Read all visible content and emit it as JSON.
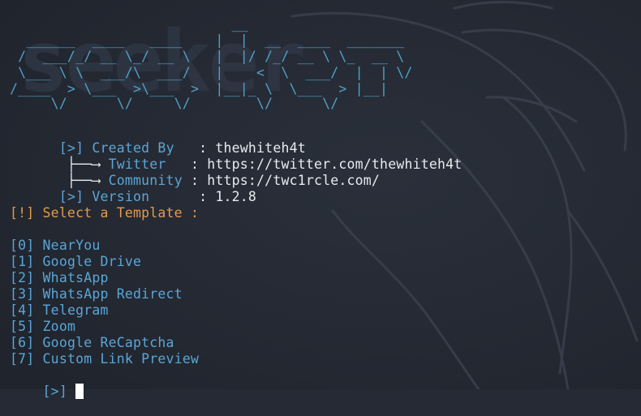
{
  "banner": {
    "ascii_lines": [
      "                           __",
      "  ______  ____   ____    |  |  __  ____  _______",
      " /  ___/_/ __ \\_/ __ \\   |  |/ /_/ __ \\ \\_  __ \\",
      " \\___ \\ \\  ___/\\  ___/   |    <  \\  ___/  |  | \\/",
      "/____  > \\___  >\\___  >  |__|_ \\  \\___  > |__|",
      "     \\/      \\/     \\/        \\/      \\/"
    ],
    "watermark_word": "seeker"
  },
  "info": [
    {
      "prefix": "[>] ",
      "label": "Created By   ",
      "sep": ": ",
      "value": "thewhiteh4t"
    },
    {
      "prefix": " ├──⟶ ",
      "label": "Twitter   ",
      "sep": ": ",
      "value": "https://twitter.com/thewhiteh4t"
    },
    {
      "prefix": " ├──⟶ ",
      "label": "Community ",
      "sep": ": ",
      "value": "https://twc1rcle.com/"
    },
    {
      "prefix": "[>] ",
      "label": "Version      ",
      "sep": ": ",
      "value": "1.2.8"
    }
  ],
  "prompt_title": "[!] Select a Template :",
  "templates": [
    {
      "index": "[0] ",
      "name": "NearYou"
    },
    {
      "index": "[1] ",
      "name": "Google Drive"
    },
    {
      "index": "[2] ",
      "name": "WhatsApp"
    },
    {
      "index": "[3] ",
      "name": "WhatsApp Redirect"
    },
    {
      "index": "[4] ",
      "name": "Telegram"
    },
    {
      "index": "[5] ",
      "name": "Zoom"
    },
    {
      "index": "[6] ",
      "name": "Google ReCaptcha"
    },
    {
      "index": "[7] ",
      "name": "Custom Link Preview"
    }
  ],
  "input_prompt": "[>] ",
  "colors": {
    "background": "#252a34",
    "accent_cyan": "#5aa6d6",
    "ascii_cyan": "#4fa0c8",
    "warning_orange": "#e49a4a",
    "value_white": "#e8ebef",
    "cursor": "#ffffff"
  }
}
